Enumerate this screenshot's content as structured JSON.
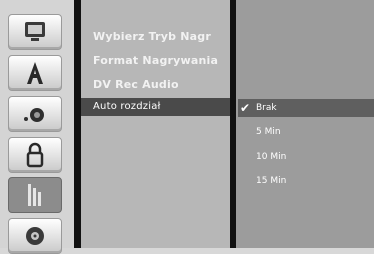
{
  "menu": {
    "items": [
      {
        "label": "Wybierz Tryb Nagr"
      },
      {
        "label": "Format Nagrywania"
      },
      {
        "label": "DV Rec Audio"
      },
      {
        "label": "Auto rozdział"
      }
    ],
    "active_index": 3
  },
  "options": {
    "items": [
      {
        "label": "Brak"
      },
      {
        "label": "5 Min"
      },
      {
        "label": "10 Min"
      },
      {
        "label": "15 Min"
      }
    ],
    "selected_index": 0,
    "check_symbol": "✔"
  },
  "rail": {
    "icons": [
      "tv-icon",
      "letter-a-icon",
      "speaker-icon",
      "lock-icon",
      "film-icon",
      "disc-icon"
    ],
    "selected_icon": "film-icon"
  }
}
